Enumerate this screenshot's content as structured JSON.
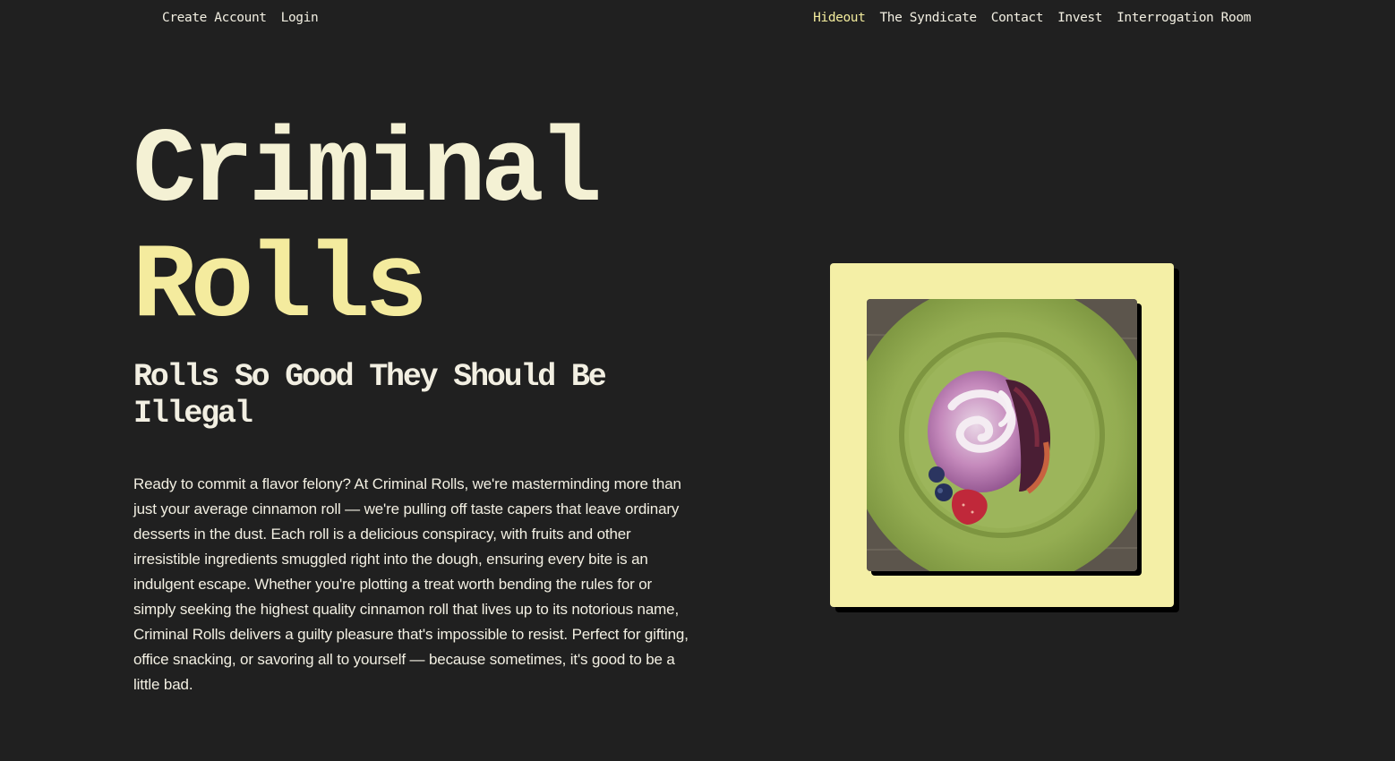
{
  "nav": {
    "left": [
      "Create Account",
      "Login"
    ],
    "right": [
      "Hideout",
      "The Syndicate",
      "Contact",
      "Invest",
      "Interrogation Room"
    ],
    "active": "Hideout"
  },
  "hero": {
    "title_line1": "Criminal",
    "title_line2": "Rolls",
    "tagline": "Rolls So Good They Should Be Illegal",
    "description": "Ready to commit a flavor felony? At Criminal Rolls, we're masterminding more than just your average cinnamon roll — we're pulling off taste capers that leave ordinary desserts in the dust. Each roll is a delicious conspiracy, with fruits and other irresistible ingredients smuggled right into the dough, ensuring every bite is an indulgent escape. Whether you're plotting a treat worth bending the rules for or simply seeking the highest quality cinnamon roll that lives up to its notorious name, Criminal Rolls delivers a guilty pleasure that's impossible to resist. Perfect for gifting, office snacking, or savoring all to yourself — because sometimes, it's good to be a little bad."
  },
  "colors": {
    "background": "#202020",
    "accent": "#f4eb9e",
    "text": "#f2efe2",
    "frame": "#f4efa6"
  }
}
